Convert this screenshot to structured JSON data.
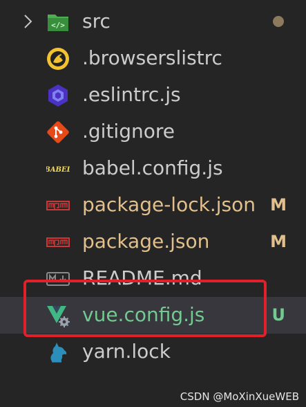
{
  "explorer": {
    "items": [
      {
        "label": "src",
        "icon": "folder-src-icon",
        "status": "dot"
      },
      {
        "label": ".browserslistrc",
        "icon": "browserslist-icon"
      },
      {
        "label": ".eslintrc.js",
        "icon": "eslint-icon"
      },
      {
        "label": ".gitignore",
        "icon": "git-icon"
      },
      {
        "label": "babel.config.js",
        "icon": "babel-icon"
      },
      {
        "label": "package-lock.json",
        "icon": "npm-icon",
        "badge": "M"
      },
      {
        "label": "package.json",
        "icon": "npm-icon",
        "badge": "M"
      },
      {
        "label": "README.md",
        "icon": "markdown-icon"
      },
      {
        "label": "vue.config.js",
        "icon": "vue-config-icon",
        "badge": "U"
      },
      {
        "label": "yarn.lock",
        "icon": "yarn-icon"
      }
    ]
  },
  "colors": {
    "background": "#252526",
    "selected_row": "#37373d",
    "modified": "#e2c08d",
    "untracked": "#73c991",
    "highlight": "#e0202b"
  },
  "watermark": "CSDN @MoXinXueWEB"
}
